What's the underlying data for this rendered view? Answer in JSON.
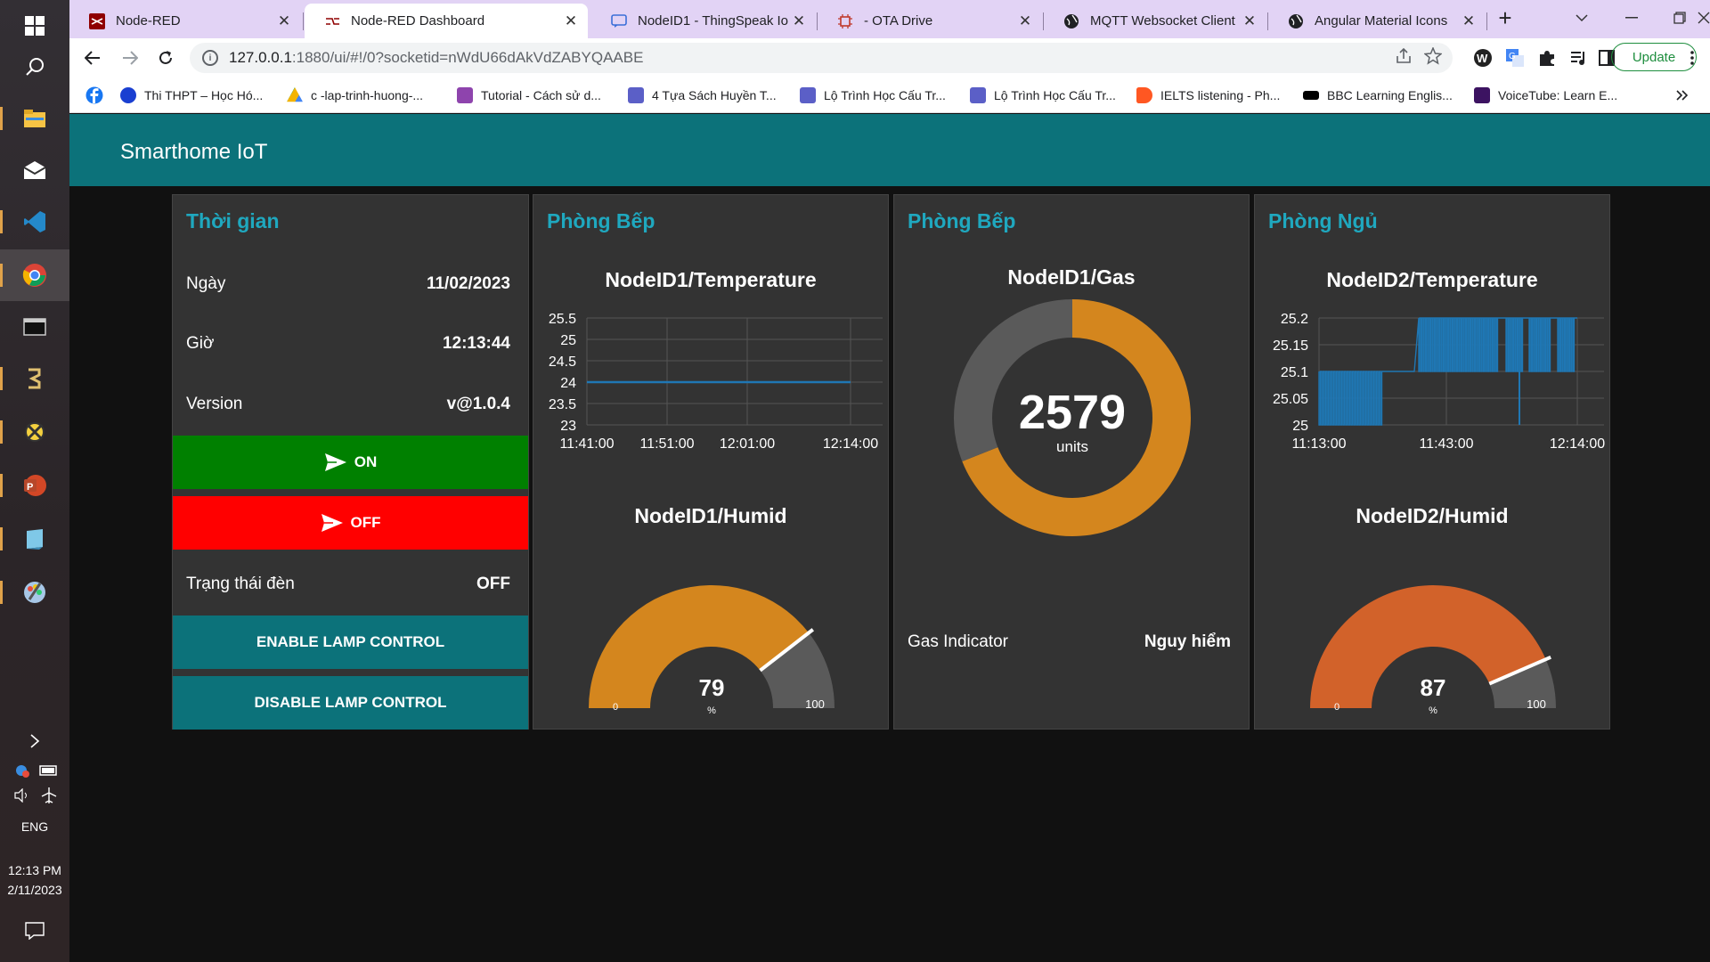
{
  "taskbar": {
    "language": "ENG",
    "time": "12:13 PM",
    "date": "2/11/2023"
  },
  "browser": {
    "tabs": [
      {
        "title": "Node-RED",
        "close": "✕"
      },
      {
        "title": "Node-RED Dashboard",
        "close": "✕"
      },
      {
        "title": "NodeID1 - ThingSpeak Io",
        "close": "✕"
      },
      {
        "title": "- OTA Drive",
        "close": "✕"
      },
      {
        "title": "MQTT Websocket Client",
        "close": "✕"
      },
      {
        "title": "Angular Material Icons",
        "close": "✕"
      }
    ],
    "url_host": "127.0.0.1",
    "url_rest": ":1880/ui/#!/0?socketid=nWdU66dAkVdZABYQAABE",
    "update_label": "Update",
    "bookmarks": [
      {
        "label": "Thi THPT – Học Hó...",
        "color": "#1a3fd1"
      },
      {
        "label": "c -lap-trinh-huong-...",
        "color": "#f4b400"
      },
      {
        "label": "Tutorial - Cách sử d...",
        "color": "#8e44ad"
      },
      {
        "label": "4 Tựa Sách Huyền T...",
        "color": "#5b5fc7"
      },
      {
        "label": "Lộ Trình Học Cấu Tr...",
        "color": "#5b5fc7"
      },
      {
        "label": "Lộ Trình Học Cấu Tr...",
        "color": "#5b5fc7"
      },
      {
        "label": "IELTS listening - Ph...",
        "color": "#ff5722"
      },
      {
        "label": "BBC Learning Englis...",
        "color": "#000000"
      },
      {
        "label": "VoiceTube: Learn E...",
        "color": "#3c1361"
      }
    ]
  },
  "dashboard": {
    "title": "Smarthome IoT",
    "time_card": {
      "title": "Thời gian",
      "rows": [
        {
          "label": "Ngày",
          "value": "11/02/2023"
        },
        {
          "label": "Giờ",
          "value": "12:13:44"
        },
        {
          "label": "Version",
          "value": "v@1.0.4"
        }
      ],
      "on_label": "ON",
      "off_label": "OFF",
      "lamp_status_label": "Trạng thái đèn",
      "lamp_status_value": "OFF",
      "enable_label": "ENABLE LAMP CONTROL",
      "disable_label": "DISABLE LAMP CONTROL",
      "colors": {
        "on": "#008000",
        "off": "#ff0000",
        "teal": "#0c727a"
      }
    },
    "kitchen1": {
      "title": "Phòng Bếp",
      "temp_title": "NodeID1/Temperature",
      "humid_title": "NodeID1/Humid",
      "humid_value": "79",
      "humid_unit": "%",
      "humid_min": "0",
      "humid_max": "100"
    },
    "kitchen2": {
      "title": "Phòng Bếp",
      "gas_title": "NodeID1/Gas",
      "gas_value": "2579",
      "gas_unit": "units",
      "gas_label": "Gas Indicator",
      "gas_status": "Nguy hiểm"
    },
    "bedroom": {
      "title": "Phòng Ngủ",
      "temp_title": "NodeID2/Temperature",
      "humid_title": "NodeID2/Humid",
      "humid_value": "87",
      "humid_unit": "%",
      "humid_min": "0",
      "humid_max": "100"
    }
  },
  "chart_data": [
    {
      "type": "line",
      "title": "NodeID1/Temperature",
      "x_ticks": [
        "11:41:00",
        "11:51:00",
        "12:01:00",
        "12:14:00"
      ],
      "y_ticks": [
        "25.5",
        "25",
        "24.5",
        "24",
        "23.5",
        "23"
      ],
      "ylim": [
        23,
        25.5
      ],
      "x": [
        "11:41:00",
        "12:14:00"
      ],
      "values": [
        24,
        24
      ],
      "color": "#1f77b4"
    },
    {
      "type": "gauge",
      "title": "NodeID1/Humid",
      "value": 79,
      "min": 0,
      "max": 100,
      "color": "#d4861e"
    },
    {
      "type": "pie",
      "title": "NodeID1/Gas",
      "value": 2579,
      "unit": "units",
      "fraction": 0.69,
      "color": "#d4861e"
    },
    {
      "type": "line",
      "title": "NodeID2/Temperature",
      "x_ticks": [
        "11:13:00",
        "11:43:00",
        "12:14:00"
      ],
      "y_ticks": [
        "25.2",
        "25.15",
        "25.1",
        "25.05",
        "25"
      ],
      "ylim": [
        25,
        25.2
      ],
      "color": "#1f77b4"
    },
    {
      "type": "gauge",
      "title": "NodeID2/Humid",
      "value": 87,
      "min": 0,
      "max": 100,
      "color": "#d2622a"
    }
  ]
}
